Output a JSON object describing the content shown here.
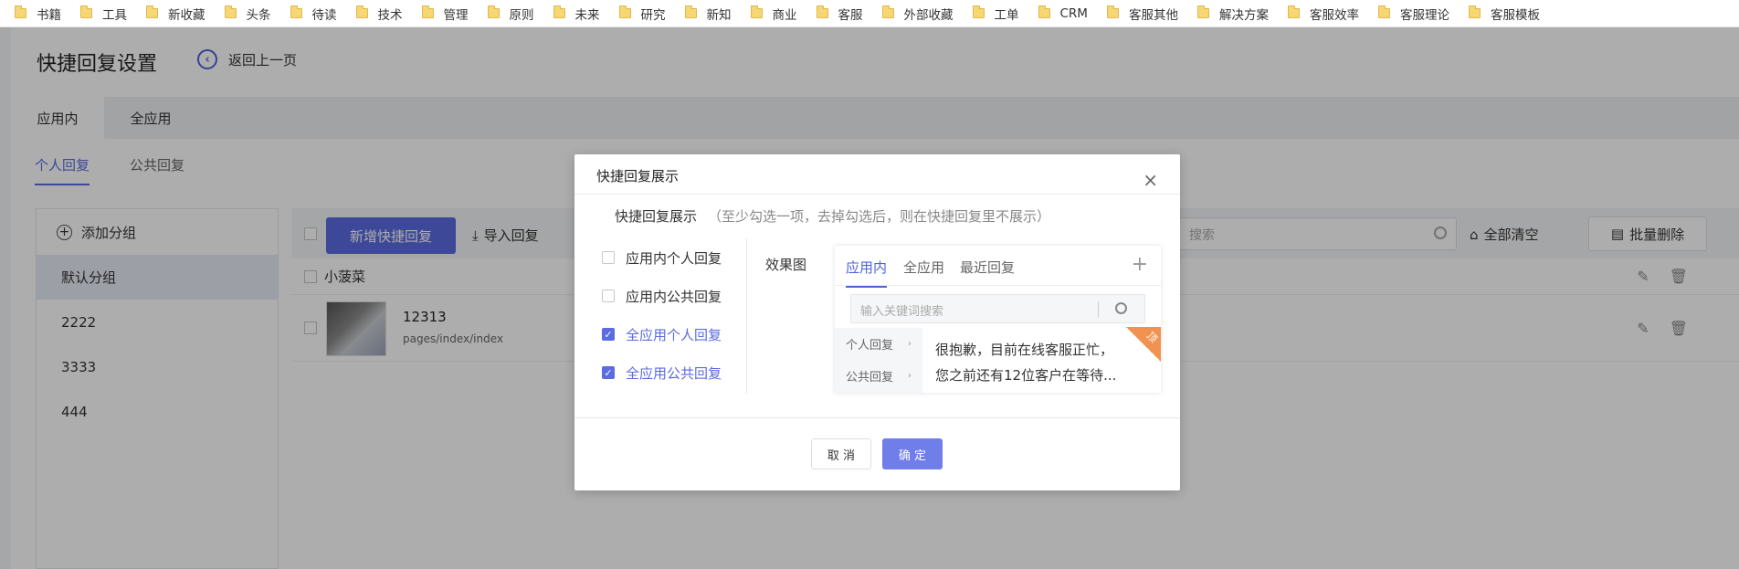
{
  "bookmarks": [
    "书籍",
    "工具",
    "新收藏",
    "头条",
    "待读",
    "技术",
    "管理",
    "原则",
    "未来",
    "研究",
    "新知",
    "商业",
    "客服",
    "外部收藏",
    "工单",
    "CRM",
    "客服其他",
    "解决方案",
    "客服效率",
    "客服理论",
    "客服模板"
  ],
  "page": {
    "title": "快捷回复设置",
    "back_label": "返回上一页",
    "top_tabs": [
      "应用内",
      "全应用"
    ],
    "sub_tabs": [
      "个人回复",
      "公共回复"
    ]
  },
  "sidebar": {
    "add_group_label": "添加分组",
    "groups": [
      "默认分组",
      "2222",
      "3333",
      "444"
    ]
  },
  "toolbar": {
    "new_reply_label": "新增快捷回复",
    "import_label": "导入回复",
    "search_placeholder": "搜索",
    "clear_all_label": "全部清空",
    "batch_delete_label": "批量删除"
  },
  "list": {
    "group_name": "小菠菜",
    "reply": {
      "title": "12313",
      "path": "pages/index/index"
    }
  },
  "dialog": {
    "title": "快捷回复展示",
    "hint_main": "快捷回复展示",
    "hint_note": "（至少勾选一项，去掉勾选后，则在快捷回复里不展示）",
    "options": [
      {
        "label": "应用内个人回复",
        "checked": false
      },
      {
        "label": "应用内公共回复",
        "checked": false
      },
      {
        "label": "全应用个人回复",
        "checked": true
      },
      {
        "label": "全应用公共回复",
        "checked": true
      }
    ],
    "preview_label": "效果图",
    "preview": {
      "tabs": [
        "应用内",
        "全应用",
        "最近回复"
      ],
      "search_placeholder": "输入关键词搜索",
      "categories": [
        "个人回复",
        "公共回复"
      ],
      "message_line1": "很抱歉，目前在线客服正忙，",
      "message_line2": "您之前还有12位客户在等待...",
      "corner_badge": "顶"
    },
    "cancel_label": "取 消",
    "confirm_label": "确 定"
  },
  "colors": {
    "accent": "#5b6be0",
    "badge": "#f29250"
  }
}
